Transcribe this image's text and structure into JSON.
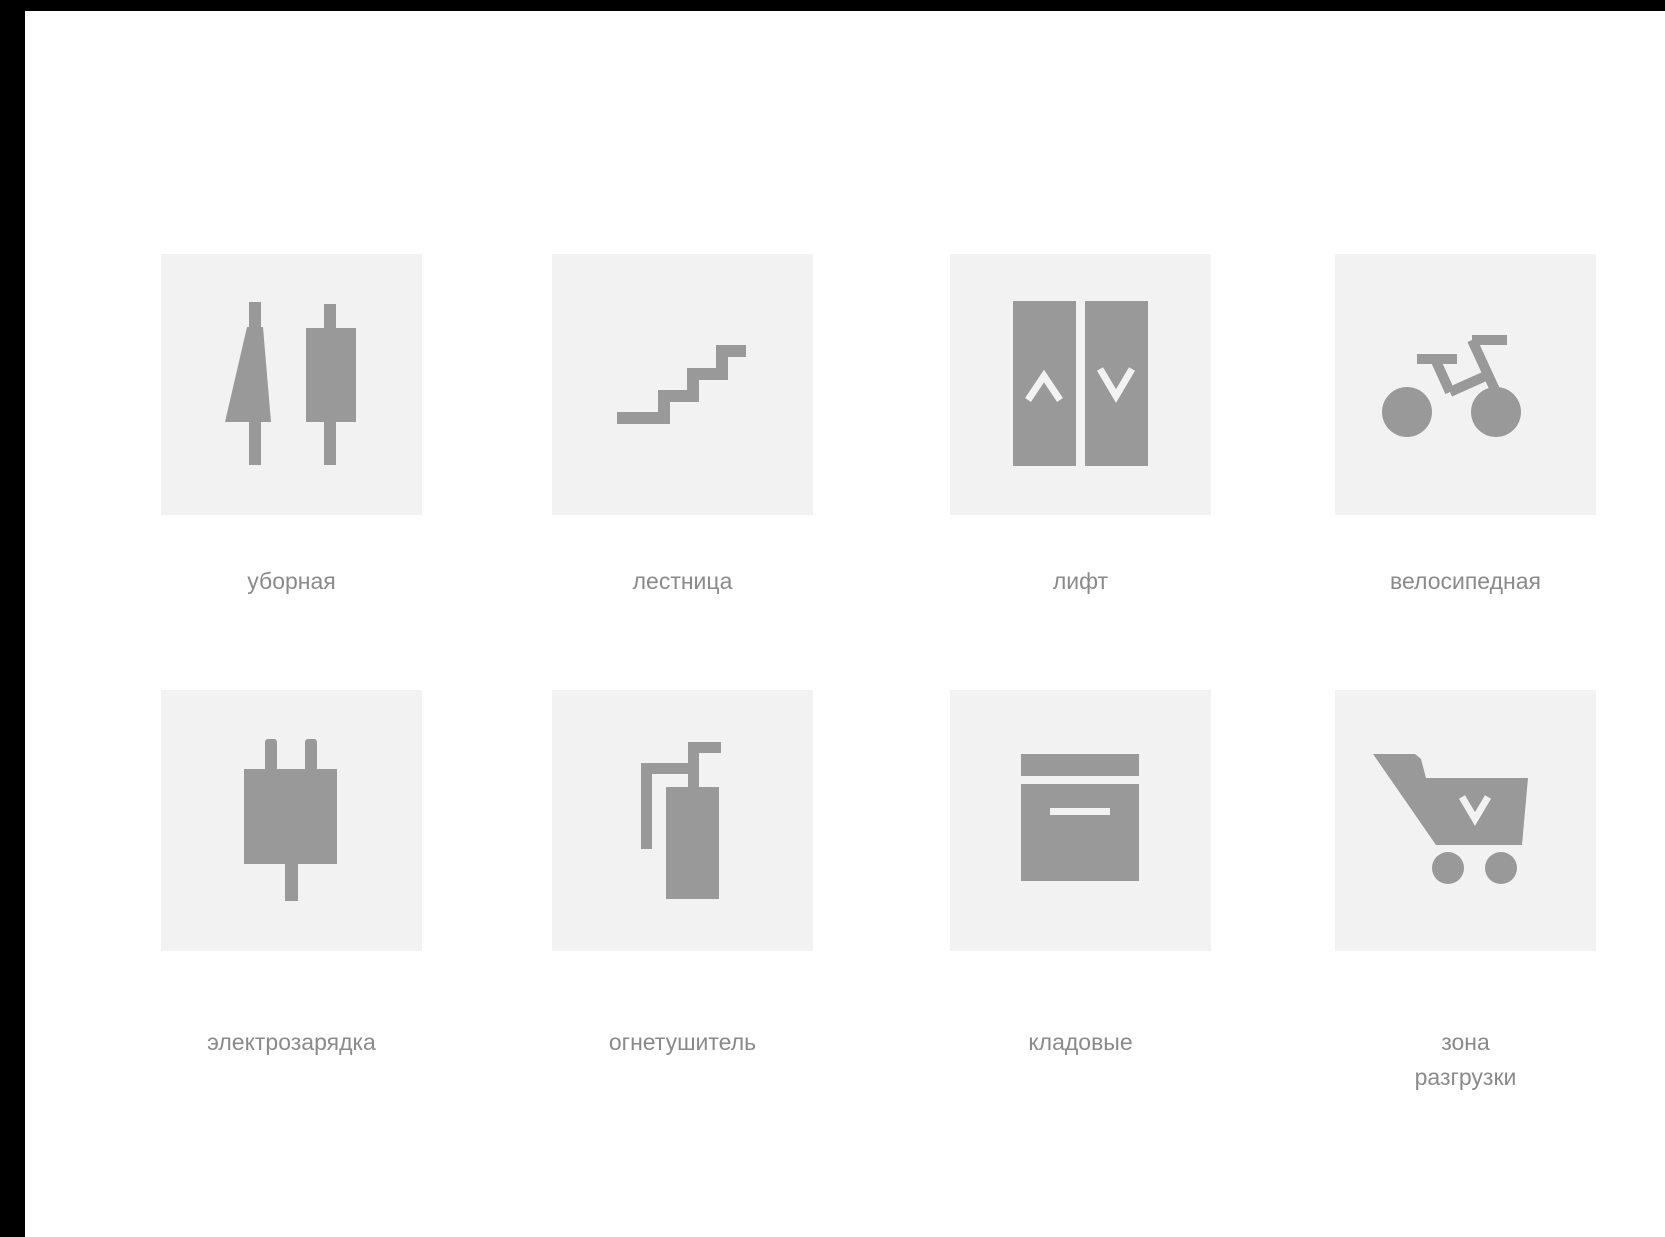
{
  "colors": {
    "frame": "#000000",
    "page": "#ffffff",
    "tile": "#f2f2f2",
    "icon": "#999999",
    "label": "#8a8a8a"
  },
  "items": [
    {
      "icon": "restroom-icon",
      "label": "уборная"
    },
    {
      "icon": "stairs-icon",
      "label": "лестница"
    },
    {
      "icon": "elevator-icon",
      "label": "лифт"
    },
    {
      "icon": "bicycle-icon",
      "label": "велосипедная"
    },
    {
      "icon": "ev-charging-plug-icon",
      "label": "электрозарядка"
    },
    {
      "icon": "fire-extinguisher-icon",
      "label": "огнетушитель"
    },
    {
      "icon": "storage-box-icon",
      "label": "кладовые"
    },
    {
      "icon": "shopping-cart-icon",
      "label": "зона\nразгрузки"
    }
  ]
}
